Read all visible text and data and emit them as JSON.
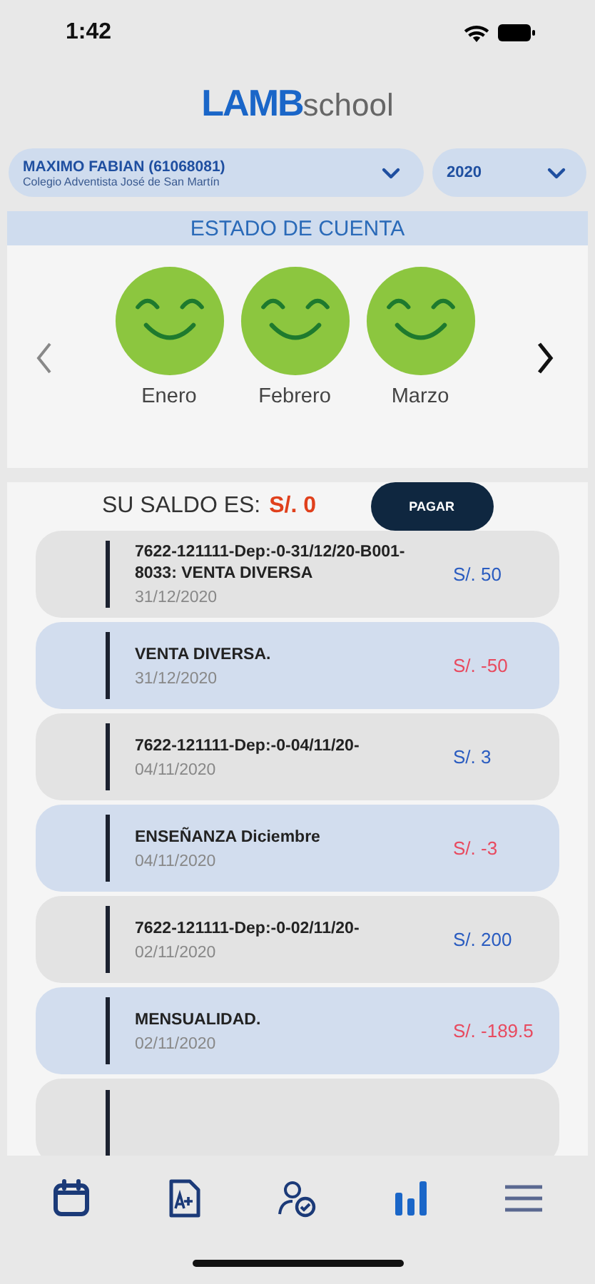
{
  "status_bar": {
    "time": "1:42"
  },
  "logo": {
    "brand": "LAMB",
    "suffix": "school"
  },
  "student_selector": {
    "name": "MAXIMO FABIAN (61068081)",
    "school": "Colegio Adventista José de San Martín"
  },
  "year_selector": {
    "value": "2020"
  },
  "section_title": "ESTADO DE CUENTA",
  "months": [
    {
      "label": "Enero",
      "kind": "happy"
    },
    {
      "label": "Febrero",
      "kind": "happy"
    },
    {
      "label": "Marzo",
      "kind": "happy"
    }
  ],
  "balance": {
    "label": "SU SALDO ES:",
    "amount": "S/. 0",
    "button": "PAGAR"
  },
  "transactions": [
    {
      "kind": "credit",
      "description": "7622-121111-Dep:-0-31/12/20-B001-8033: VENTA DIVERSA",
      "date": "31/12/2020",
      "amount": "S/. 50"
    },
    {
      "kind": "debit",
      "description": "VENTA DIVERSA.",
      "date": "31/12/2020",
      "amount": "S/. -50"
    },
    {
      "kind": "credit",
      "description": "7622-121111-Dep:-0-04/11/20-",
      "date": "04/11/2020",
      "amount": "S/. 3"
    },
    {
      "kind": "debit",
      "description": "ENSEÑANZA Diciembre",
      "date": "04/11/2020",
      "amount": "S/. -3"
    },
    {
      "kind": "credit",
      "description": "7622-121111-Dep:-0-02/11/20-",
      "date": "02/11/2020",
      "amount": "S/. 200"
    },
    {
      "kind": "debit",
      "description": "MENSUALIDAD.",
      "date": "02/11/2020",
      "amount": "S/. -189.5"
    }
  ],
  "tab_bar": [
    {
      "kind": "calendar",
      "selected": false
    },
    {
      "kind": "grades",
      "selected": false
    },
    {
      "kind": "attendance",
      "selected": false
    },
    {
      "kind": "account",
      "selected": true
    },
    {
      "kind": "menu",
      "selected": false
    }
  ]
}
